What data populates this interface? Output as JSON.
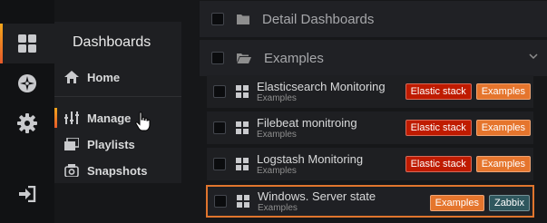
{
  "sidebar_rail": {
    "items": [
      {
        "icon": "apps-grid-icon",
        "active": true
      },
      {
        "icon": "compass-icon",
        "active": false
      },
      {
        "icon": "gear-icon",
        "active": false
      },
      {
        "icon": "sign-in-icon",
        "active": false
      }
    ]
  },
  "menu": {
    "title": "Dashboards",
    "items": [
      {
        "label": "Home",
        "icon": "home-icon"
      },
      {
        "label": "Manage",
        "icon": "manage-icon",
        "active": true
      },
      {
        "label": "Playlists",
        "icon": "playlist-icon"
      },
      {
        "label": "Snapshots",
        "icon": "snapshot-icon"
      }
    ]
  },
  "folders": [
    {
      "label": "Detail Dashboards",
      "icon": "folder-icon"
    },
    {
      "label": "Examples",
      "icon": "folder-open-icon",
      "expanded": true
    }
  ],
  "dashboards": [
    {
      "title": "Elasticsearch Monitoring",
      "folder": "Examples",
      "tags": [
        "Elastic stack",
        "Examples"
      ]
    },
    {
      "title": "Filebeat monitroing",
      "folder": "Examples",
      "tags": [
        "Elastic stack",
        "Examples"
      ]
    },
    {
      "title": "Logstash Monitoring",
      "folder": "Examples",
      "tags": [
        "Elastic stack",
        "Examples"
      ]
    },
    {
      "title": "Windows. Server state",
      "folder": "Examples",
      "tags": [
        "Examples",
        "Zabbix"
      ],
      "selected": true
    }
  ],
  "tag_colors": {
    "Elastic stack": "#bf1b00",
    "Examples": "#e5752d",
    "Zabbix": "#2f575e"
  }
}
